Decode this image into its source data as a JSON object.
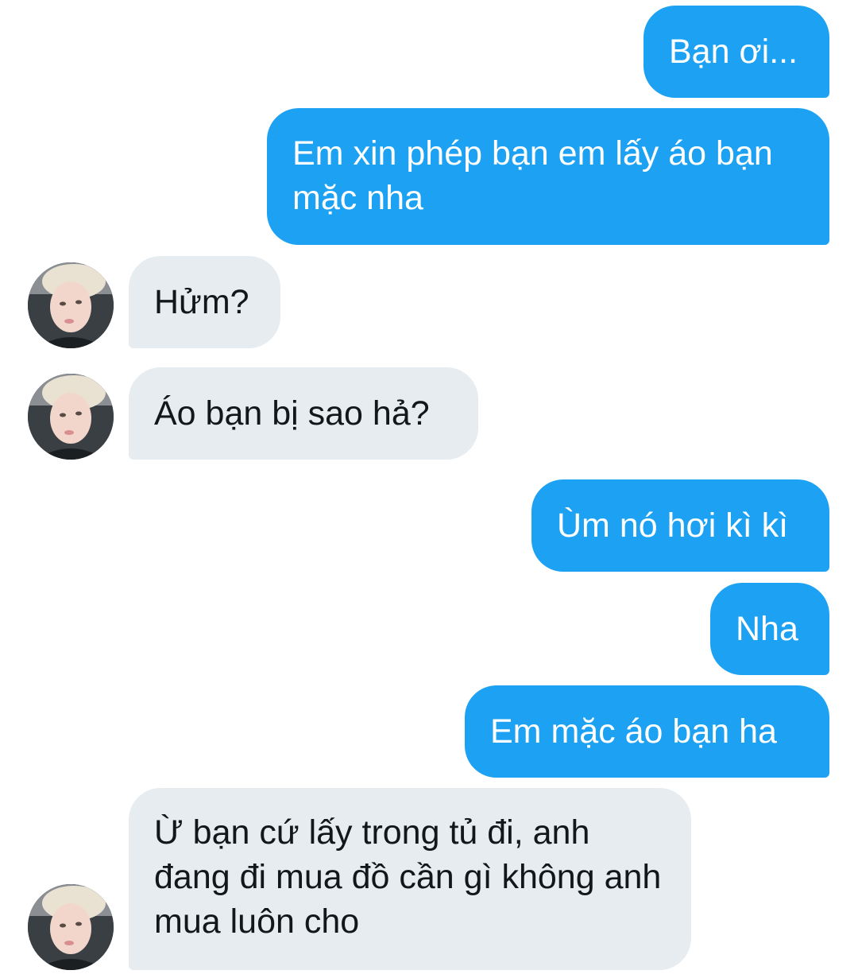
{
  "conversation": {
    "messages": [
      {
        "direction": "outgoing",
        "text": "Bạn ơi..."
      },
      {
        "direction": "outgoing",
        "text": "Em xin phép bạn em lấy áo bạn mặc nha"
      },
      {
        "direction": "incoming",
        "text": "Hửm?"
      },
      {
        "direction": "incoming",
        "text": "Áo bạn bị sao hả?"
      },
      {
        "direction": "outgoing",
        "text": "Ùm nó hơi kì kì"
      },
      {
        "direction": "outgoing",
        "text": "Nha"
      },
      {
        "direction": "outgoing",
        "text": "Em mặc áo bạn ha"
      },
      {
        "direction": "incoming",
        "text": "Ừ bạn cứ lấy trong tủ đi, anh đang đi mua đồ cần gì không anh mua luôn cho"
      }
    ]
  },
  "colors": {
    "outgoing_bubble": "#1da1f2",
    "incoming_bubble": "#e6ecf0",
    "outgoing_text": "#ffffff",
    "incoming_text": "#14171a",
    "background": "#ffffff"
  },
  "icons": {
    "contact_avatar": "contact-avatar-photo"
  }
}
